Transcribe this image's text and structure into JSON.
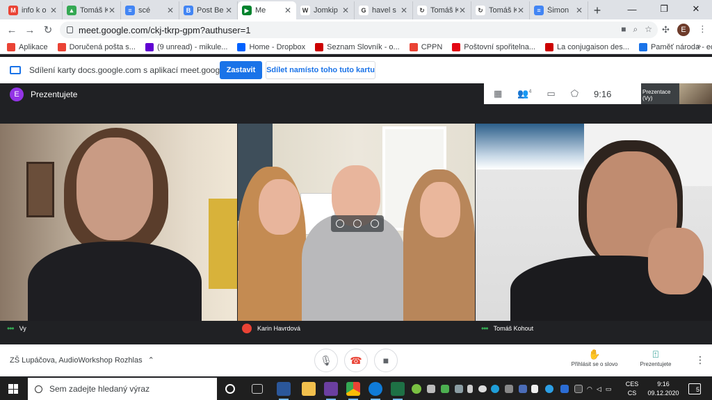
{
  "browser": {
    "tabs": [
      {
        "title": "info k o",
        "color": "#ea4335",
        "glyph": "M"
      },
      {
        "title": "Tomáš K",
        "color": "#34a853",
        "glyph": "▲"
      },
      {
        "title": "scé",
        "color": "#4285f4",
        "glyph": "≡"
      },
      {
        "title": "Post Be",
        "color": "#4285f4",
        "glyph": "B"
      },
      {
        "title": "Me",
        "color": "#00832d",
        "glyph": "▶",
        "active": true
      },
      {
        "title": "Jomkip",
        "color": "#ffffff",
        "glyph": "W"
      },
      {
        "title": "havel s",
        "color": "#ffffff",
        "glyph": "G"
      },
      {
        "title": "Tomáš K",
        "color": "#ffffff",
        "glyph": "↻"
      },
      {
        "title": "Tomáš K",
        "color": "#ffffff",
        "glyph": "↻"
      },
      {
        "title": "Šimon",
        "color": "#4285f4",
        "glyph": "≡"
      }
    ],
    "new_tab": "+",
    "url": "meet.google.com/ckj-tkrp-gpm?authuser=1",
    "profile_initial": "E",
    "bookmarks": [
      {
        "label": "Aplikace",
        "color": "#ea4335"
      },
      {
        "label": "Doručená pošta s...",
        "color": "#ea4335"
      },
      {
        "label": "(9 unread) - mikule...",
        "color": "#6001d2"
      },
      {
        "label": "Home - Dropbox",
        "color": "#0061fe"
      },
      {
        "label": "Seznam Slovník - o...",
        "color": "#cc0000"
      },
      {
        "label": "CPPN",
        "color": "#ea4335"
      },
      {
        "label": "Poštovní spořitelna...",
        "color": "#e30613"
      },
      {
        "label": "La conjugaison des...",
        "color": "#cc0000"
      },
      {
        "label": "Paměť národa - edi...",
        "color": "#1a73e8"
      }
    ],
    "bookmarks_more": "»"
  },
  "share_bar": {
    "message": "Sdílení karty docs.google.com s aplikací meet.google.com",
    "stop_label": "Zastavit",
    "share_this_label": "Sdílet namísto toho tuto kartu"
  },
  "meet": {
    "presenting_initial": "E",
    "presenting_label": "Prezentujete",
    "participants_count": "4",
    "time": "9:16",
    "self_thumb_label": "Prezentace (Vy)",
    "self_thumb_name": "Vy",
    "tiles": [
      {
        "name": "Vy"
      },
      {
        "name": "Karin Havrdová",
        "muted": true
      },
      {
        "name": "Tomáš Kohout"
      }
    ],
    "meeting_name": "ZŠ Lupáčova, AudioWorkshop Rozhlas",
    "raise_hand_label": "Přihlásit se o slovo",
    "present_label": "Prezentujete"
  },
  "taskbar": {
    "search_placeholder": "Sem zadejte hledaný výraz",
    "lang_top": "CES",
    "lang_bottom": "CS",
    "clock_time": "9:16",
    "clock_date": "09.12.2020",
    "notifications": "5"
  },
  "colors": {
    "accent": "#1a73e8",
    "meet_bg": "#202124",
    "danger": "#ea4335"
  }
}
